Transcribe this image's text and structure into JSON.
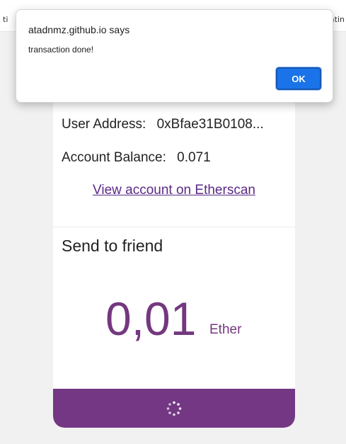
{
  "browser": {
    "left_fragment": "ti",
    "right_fragment": "atin"
  },
  "account": {
    "user_address_label": "User Address:",
    "user_address_value": "0xBfae31B0108...",
    "balance_label": "Account Balance:",
    "balance_value": "0.071",
    "etherscan_link": "View account on Etherscan"
  },
  "send": {
    "title": "Send to friend",
    "amount": "0,01",
    "unit": "Ether",
    "button_state": "loading-spinner-icon"
  },
  "dialog": {
    "origin": "atadnmz.github.io says",
    "message": "transaction done!",
    "ok_label": "OK"
  },
  "colors": {
    "accent_purple": "#733783",
    "ok_blue": "#1a73e8"
  }
}
